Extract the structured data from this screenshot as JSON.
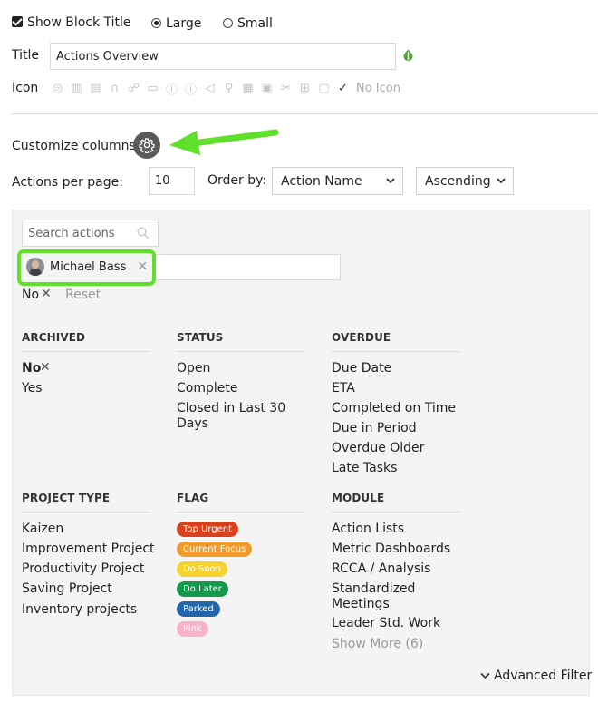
{
  "block": {
    "show_title_label": "Show Block Title",
    "size_large": "Large",
    "size_small": "Small",
    "title_label": "Title",
    "title_value": "Actions Overview",
    "icon_label": "Icon",
    "no_icon": "No Icon"
  },
  "customize": {
    "label": "Customize columns"
  },
  "paging": {
    "per_page_label": "Actions per page:",
    "per_page_value": "10",
    "order_label": "Order by:",
    "order_value": "Action Name",
    "direction_value": "Ascending"
  },
  "filters": {
    "search_placeholder": "Search actions",
    "user_chip": "Michael Bass",
    "active_filter": "No",
    "reset": "Reset",
    "advanced": "Advanced Filter",
    "archived": {
      "heading": "ARCHIVED",
      "items": [
        "No",
        "Yes"
      ]
    },
    "status": {
      "heading": "STATUS",
      "items": [
        "Open",
        "Complete",
        "Closed in Last 30",
        "Days"
      ]
    },
    "overdue": {
      "heading": "OVERDUE",
      "items": [
        "Due Date",
        "ETA",
        "Completed on Time",
        "Due in Period",
        "Overdue Older",
        "Late Tasks"
      ]
    },
    "project_type": {
      "heading": "PROJECT TYPE",
      "items": [
        "Kaizen",
        "Improvement Project",
        "Productivity Project",
        "Saving Project",
        "Inventory projects"
      ]
    },
    "flag": {
      "heading": "FLAG",
      "items": [
        "Top Urgent",
        "Current Focus",
        "Do Soon",
        "Do Later",
        "Parked",
        "Pink"
      ]
    },
    "module": {
      "heading": "MODULE",
      "items": [
        "Action Lists",
        "Metric Dashboards",
        "RCCA / Analysis",
        "Standardized",
        "Meetings",
        "Leader Std. Work"
      ],
      "show_more": "Show More (6)"
    }
  },
  "colors": {
    "highlight": "#5fe02a",
    "arrow": "#5fe02a",
    "flag_top_urgent": "#d9401c",
    "flag_current_focus": "#f39a2c",
    "flag_do_soon": "#f5d22c",
    "flag_do_later": "#139a4a",
    "flag_parked": "#2167a9",
    "flag_pink": "#f6b2c8"
  }
}
